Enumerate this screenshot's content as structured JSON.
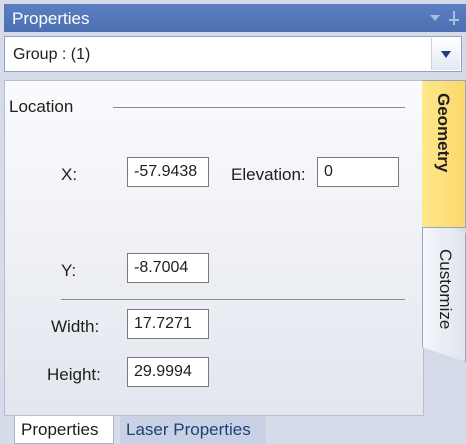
{
  "panel": {
    "title": "Properties"
  },
  "group_selector": {
    "value": "Group : (1)"
  },
  "location": {
    "section_title": "Location",
    "x_label": "X:",
    "x_value": "-57.9438",
    "y_label": "Y:",
    "y_value": "-8.7004",
    "elevation_label": "Elevation:",
    "elevation_value": "0",
    "width_label": "Width:",
    "width_value": "17.7271",
    "height_label": "Height:",
    "height_value": "29.9994"
  },
  "side_tabs": [
    {
      "label": "Geometry",
      "active": true
    },
    {
      "label": "Customize",
      "active": false
    }
  ],
  "bottom_tabs": [
    {
      "label": "Properties",
      "active": true
    },
    {
      "label": "Laser Properties",
      "active": false
    }
  ],
  "colors": {
    "title_bar": "#4c70b1",
    "active_side_tab": "#fbd86b",
    "panel_background": "#d6dbe9"
  },
  "icons": {
    "title_dropdown": "triangle-down-icon",
    "title_pin": "pin-icon",
    "combo_dropdown": "chevron-down-icon"
  }
}
